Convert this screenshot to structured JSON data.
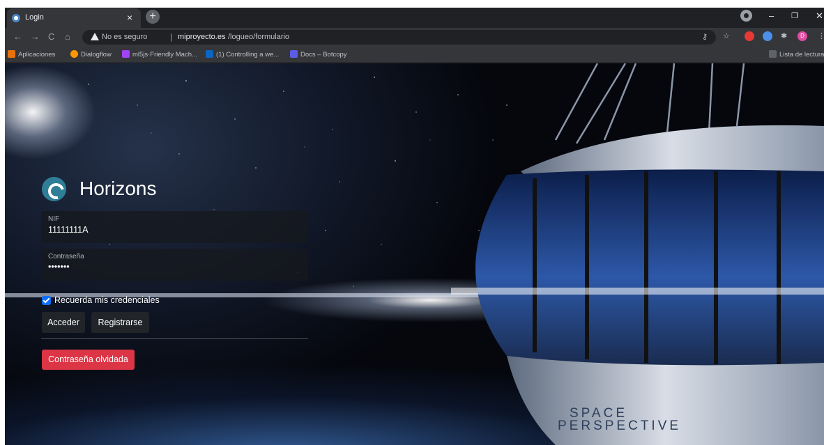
{
  "browser": {
    "tab": {
      "title": "Login",
      "close": "×"
    },
    "new_tab": "+",
    "window_controls": {
      "minimize": "–",
      "maximize": "❐",
      "close": "✕"
    },
    "nav": {
      "back": "←",
      "forward": "→",
      "reload": "C",
      "home": "⌂"
    },
    "address": {
      "security_text": "No es seguro",
      "separator": "|",
      "host": "miproyecto.es",
      "path": "/logueo/formulario"
    },
    "bookmarks": [
      {
        "label": "Aplicaciones",
        "icon": "apps-grid-icon",
        "color": "#e8710a"
      },
      {
        "label": "Dialogflow",
        "icon": "dialogflow-icon",
        "color": "#ff9800"
      },
      {
        "label": "ml5js·Friendly Mach...",
        "icon": "ml5-icon",
        "color": "#a142f4"
      },
      {
        "label": "(1) Controlling a we...",
        "icon": "linkedin-icon",
        "color": "#0a66c2"
      },
      {
        "label": "Docs – Botcopy",
        "icon": "docs-icon",
        "color": "#5e5ce6"
      }
    ],
    "reading_list": "Lista de lectura",
    "profile_initial": "D"
  },
  "login": {
    "brand": "Horizons",
    "nif": {
      "label": "NIF",
      "value": "11111111A"
    },
    "password": {
      "label": "Contraseña",
      "value": "•••••••"
    },
    "remember": {
      "label": "Recuerda mis credenciales",
      "checked": true
    },
    "buttons": {
      "login": "Acceder",
      "register": "Registrarse",
      "forgot": "Contraseña olvidada"
    }
  },
  "background": {
    "capsule_brand_line1": "SPACE",
    "capsule_brand_line2": "PERSPECTIVE"
  },
  "colors": {
    "accent": "#0d6efd",
    "danger": "#dc3545",
    "button_dark": "#212529",
    "logo": "#2f7d96"
  }
}
